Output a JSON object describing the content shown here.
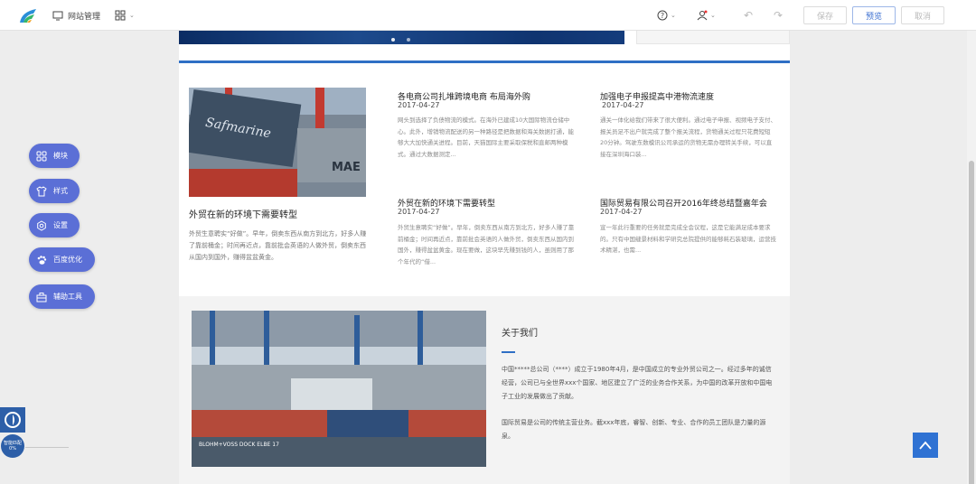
{
  "toolbar": {
    "site_manage": "网站管理",
    "save": "保存",
    "preview": "预览",
    "cancel": "取消"
  },
  "left_tools": [
    {
      "label": "模块",
      "icon": "grid-icon"
    },
    {
      "label": "样式",
      "icon": "shirt-icon"
    },
    {
      "label": "设置",
      "icon": "gear-icon"
    },
    {
      "label": "百度优化",
      "icon": "paw-icon"
    },
    {
      "label": "辅助工具",
      "icon": "toolbox-icon"
    }
  ],
  "widget": {
    "line1": "智能匹配",
    "line2": "0%"
  },
  "news": {
    "featured": {
      "title": "外贸在新的环境下需要转型",
      "text": "外贸生意聘实“好做”。早年，倒卖东西从南方到北方，好多人赚了靠前桶金；时间再近点，靠前批会英语的人做外贸，倒卖东西从国内到国外，赚得盆盆黄金。"
    },
    "items": [
      {
        "title": "各电商公司扎堆跨境电商 布局海外购",
        "date": "2017-04-27",
        "text": "网头到选择了负债物流的模式。在海外已建成10大国际物流仓储中心。此外，增销物流配送的另一种路径是把数据和海关数据打通，能够大大加快通关进程。目前，天猫国际主要采取保税和直邮两种模式。通过大数据测定..."
      },
      {
        "title": "加强电子申报提高中港物流速度",
        "date": "2017-04-27",
        "text": "通关一体化给我们带来了很大便利。通过电子申报、视频电子支付、报关员足不出户就完成了整个报关流程，货物通关过程只花费短短20分钟。驾驶东数模讯公司承运的货物无需办理转关手续，可以直接在深圳海口装..."
      },
      {
        "title": "外贸在新的环境下需要转型",
        "date": "2017-04-27",
        "text": "外贸生意聘实“好做”。早年，倒卖东西从南方到北方，好多人赚了靠前桶金；时间再近点，靠前批会英语的人做外贸，倒卖东西从国内到国外，赚得盆盆黄金。现在要做，这块早先赚到钱的人，虽则用了那个年代的“借..."
      },
      {
        "title": "国际贸易有限公司召开2016年终总结暨嘉年会",
        "date": "2017-04-27",
        "text": "宣一年此行重要的任务就是完成全会议程，这是它能满足成本要求的。只有中国缝景材料和学研究总院提供的能够耗石装玻璃，运营技术精湛，也需..."
      }
    ]
  },
  "about": {
    "title": "关于我们",
    "p1": "中国*****总公司（****）成立于1980年4月，是中国成立的专业外贸公司之一。经过多年的诚信经营，公司已与全世界xxx个国家、地区建立了广泛的业务合作关系，为中国的改革开放和中国电子工业的发展做出了贡献。",
    "p2": "国际贸易是公司的传统主营业务。截xxx年底，睿智、创新、专业、合作的员工团队是力量的源泉。"
  },
  "colors": {
    "accent": "#2f6fc5",
    "tool_bg": "#5b6fd6",
    "to_top": "#2f72d3"
  }
}
